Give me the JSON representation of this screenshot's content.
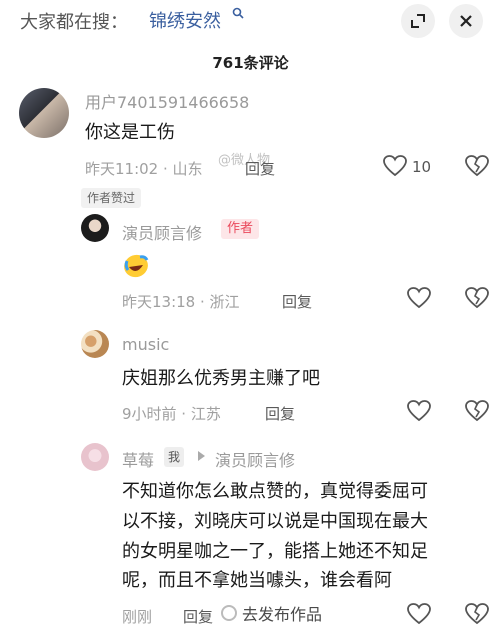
{
  "header": {
    "search_prefix": "大家都在搜：",
    "search_term": "锦绣安然",
    "comment_count_title": "761条评论"
  },
  "comments": [
    {
      "username": "用户7401591466658",
      "content": "你这是工伤",
      "meta": "昨天11:02 · 山东",
      "reply_label": "回复",
      "likes": "10",
      "badge": "作者赞过"
    },
    {
      "username": "演员顾言修",
      "author_badge": "作者",
      "meta": "昨天13:18 · 浙江",
      "reply_label": "回复"
    },
    {
      "username": "music",
      "content": "庆姐那么优秀男主赚了吧",
      "meta": "9小时前 · 江苏",
      "reply_label": "回复"
    },
    {
      "username": "草莓",
      "self_badge": "我",
      "reply_to": "演员顾言修",
      "content_lines": [
        "不知道你怎么敢点赞的，真觉得委屈可",
        "以不接，刘晓庆可以说是中国现在最大",
        "的女明星咖之一了，能搭上她还不知足",
        "呢，而且不拿她当噱头，谁会看阿"
      ],
      "meta": "刚刚",
      "reply_label": "回复"
    }
  ],
  "overlay": {
    "watermark": "@微人物",
    "publish_label": "去发布作品"
  },
  "colors": {
    "search_term": "#3a5f9f",
    "author_badge_bg": "#fde6e8",
    "author_badge_text": "#ea4b5d"
  }
}
